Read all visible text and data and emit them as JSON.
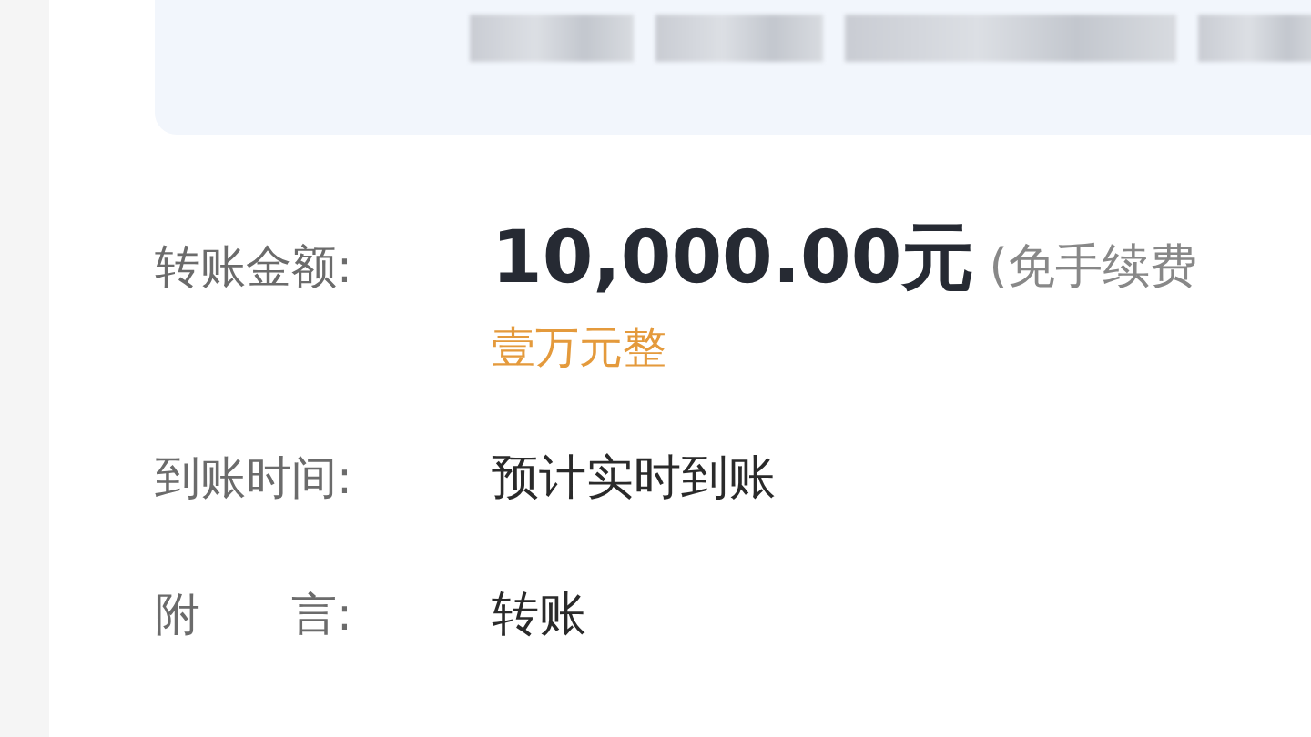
{
  "summary_panel": {
    "kind": "blurred"
  },
  "fields": [
    {
      "label": "转账金额:",
      "value": "10,000.00元",
      "kind": "amount",
      "note": "(免手续费",
      "subtext": "壹万元整"
    },
    {
      "label": "到账时间:",
      "value": "预计实时到账",
      "kind": "plain"
    },
    {
      "label": "附　　言:",
      "value": "转账",
      "kind": "plain"
    }
  ]
}
